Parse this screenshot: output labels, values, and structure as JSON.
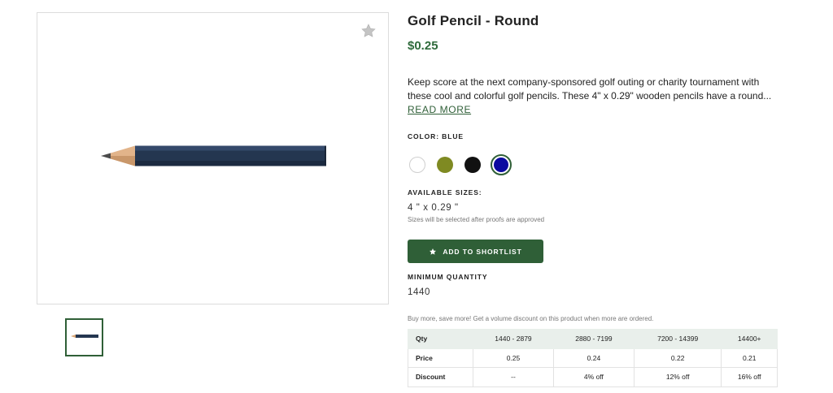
{
  "product": {
    "title": "Golf Pencil - Round",
    "price": "$0.25",
    "description_lines": [
      "Keep score at the next company-sponsored golf outing or charity tournament with",
      "these cool and colorful golf pencils. These 4\" x 0.29\" wooden pencils have a round..."
    ],
    "read_more": "READ MORE"
  },
  "color": {
    "label": "COLOR: BLUE",
    "options": [
      {
        "name": "white",
        "hex": "#ffffff",
        "selected": false
      },
      {
        "name": "olive",
        "hex": "#7f8a22",
        "selected": false
      },
      {
        "name": "black",
        "hex": "#111111",
        "selected": false
      },
      {
        "name": "blue",
        "hex": "#0c0aa0",
        "selected": true
      }
    ]
  },
  "sizes": {
    "label": "AVAILABLE SIZES:",
    "value": "4 \" x 0.29 \"",
    "note": "Sizes will be selected after proofs are approved"
  },
  "shortlist_button": {
    "label": "ADD TO SHORTLIST",
    "icon": "star-icon"
  },
  "minimum": {
    "label": "MINIMUM QUANTITY",
    "value": "1440"
  },
  "volume": {
    "note": "Buy more, save more! Get a volume discount on this product when more are ordered.",
    "rows": [
      [
        "Qty",
        "1440 - 2879",
        "2880 - 7199",
        "7200 - 14399",
        "14400+"
      ],
      [
        "Price",
        "0.25",
        "0.24",
        "0.22",
        "0.21"
      ],
      [
        "Discount",
        "--",
        "4% off",
        "12% off",
        "16% off"
      ]
    ]
  },
  "icons": {
    "favorite": "star-icon",
    "main_image": "pencil-image",
    "thumbnail": "pencil-thumbnail"
  },
  "colors": {
    "accent": "#2f5f37",
    "price": "#2f6b3c",
    "table_header_bg": "#e9efeb"
  }
}
